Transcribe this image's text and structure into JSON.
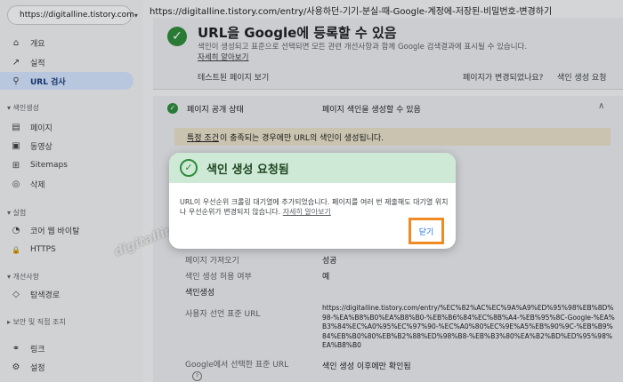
{
  "property": {
    "label": "https://digitalline.tistory.com",
    "caret": "▾"
  },
  "sidebar": {
    "items_top": [
      {
        "label": "개요",
        "icon": "home-icon",
        "glyph": "⌂"
      },
      {
        "label": "실적",
        "icon": "trend-icon",
        "glyph": "↗"
      },
      {
        "label": "URL 검사",
        "icon": "search-icon",
        "glyph": "⚲"
      }
    ],
    "index_section": "▾ 색인생성",
    "index_items": [
      {
        "label": "페이지",
        "icon": "pages-icon",
        "glyph": "▤"
      },
      {
        "label": "동영상",
        "icon": "video-icon",
        "glyph": "▣"
      },
      {
        "label": "Sitemaps",
        "icon": "sitemap-icon",
        "glyph": "⊞"
      },
      {
        "label": "삭제",
        "icon": "hide-icon",
        "glyph": "◎"
      }
    ],
    "exp_section": "▾ 실험",
    "exp_items": [
      {
        "label": "코어 웹 바이탈",
        "icon": "speed-icon",
        "glyph": "◔"
      },
      {
        "label": "HTTPS",
        "icon": "lock-icon",
        "glyph": "🔒"
      }
    ],
    "enh_section": "▾ 개선사항",
    "enh_items": [
      {
        "label": "탐색경로",
        "icon": "breadcrumb-icon",
        "glyph": "◇"
      }
    ],
    "sec_section": "▸ 보안 및 직접 조치",
    "bottom_items": [
      {
        "label": "링크",
        "icon": "link-icon",
        "glyph": "⚭"
      },
      {
        "label": "설정",
        "icon": "gear-icon",
        "glyph": "⚙"
      }
    ]
  },
  "inspected_url": "https://digitalline.tistory.com/entry/사용하던-기기-분실-때-Google-계정에-저장된-비밀번호-변경하기",
  "status_card": {
    "title": "URL을 Google에 등록할 수 있음",
    "desc": "색인이 생성되고 표준으로 선택되면 모든 관련 개선사항과 함께 Google 검색결과에 표시될 수 있습니다.",
    "learn_more": "자세히 알아보기",
    "tested_page": "테스트된 페이지 보기",
    "page_changed": "페이지가 변경되었나요?",
    "request_index": "색인 생성 요청"
  },
  "availability": {
    "title": "페이지 공개 상태",
    "value": "페이지 색인을 생성할 수 있음",
    "notice_link": "특정 조건",
    "notice_text": "이 충족되는 경우에만 URL의 색인이 생성됩니다.",
    "rows": [
      {
        "label": "페이지 가져오기",
        "value": "성공"
      },
      {
        "label": "색인 생성 허용 여부",
        "value": "예"
      }
    ],
    "indexing_heading": "색인생성",
    "canonical_label": "사용자 선언 표준 URL",
    "canonical_value": "https://digitalline.tistory.com/entry/%EC%82%AC%EC%9A%A9%ED%95%98%EB%8D%98-%EA%B8%B0%EA%B8%B0-%EB%B6%84%EC%8B%A4-%EB%95%8C-Google-%EA%B3%84%EC%A0%95%EC%97%90-%EC%A0%80%EC%9E%A5%EB%90%9C-%EB%B9%84%EB%B0%80%EB%B2%88%ED%98%B8-%EB%B3%80%EA%B2%BD%ED%95%98%EA%B8%B0",
    "google_canonical_label": "Google에서 선택한 표준 URL",
    "google_canonical_value": "색인 생성 이후에만 확인됨"
  },
  "watermark": "digitalline",
  "dialog": {
    "title": "색인 생성 요청됨",
    "body": "URL이 우선순위 크롤링 대기열에 추가되었습니다. 페이지를 여러 번 제출해도 대기열 위치나 우선순위가 변경되지 않습니다.",
    "learn_more": "자세히 알아보기",
    "close_label": "닫기"
  },
  "colors": {
    "accent": "#1a73e8",
    "success": "#2e8b3d",
    "highlight": "#f08a24",
    "dialog_header": "#ceead6"
  }
}
